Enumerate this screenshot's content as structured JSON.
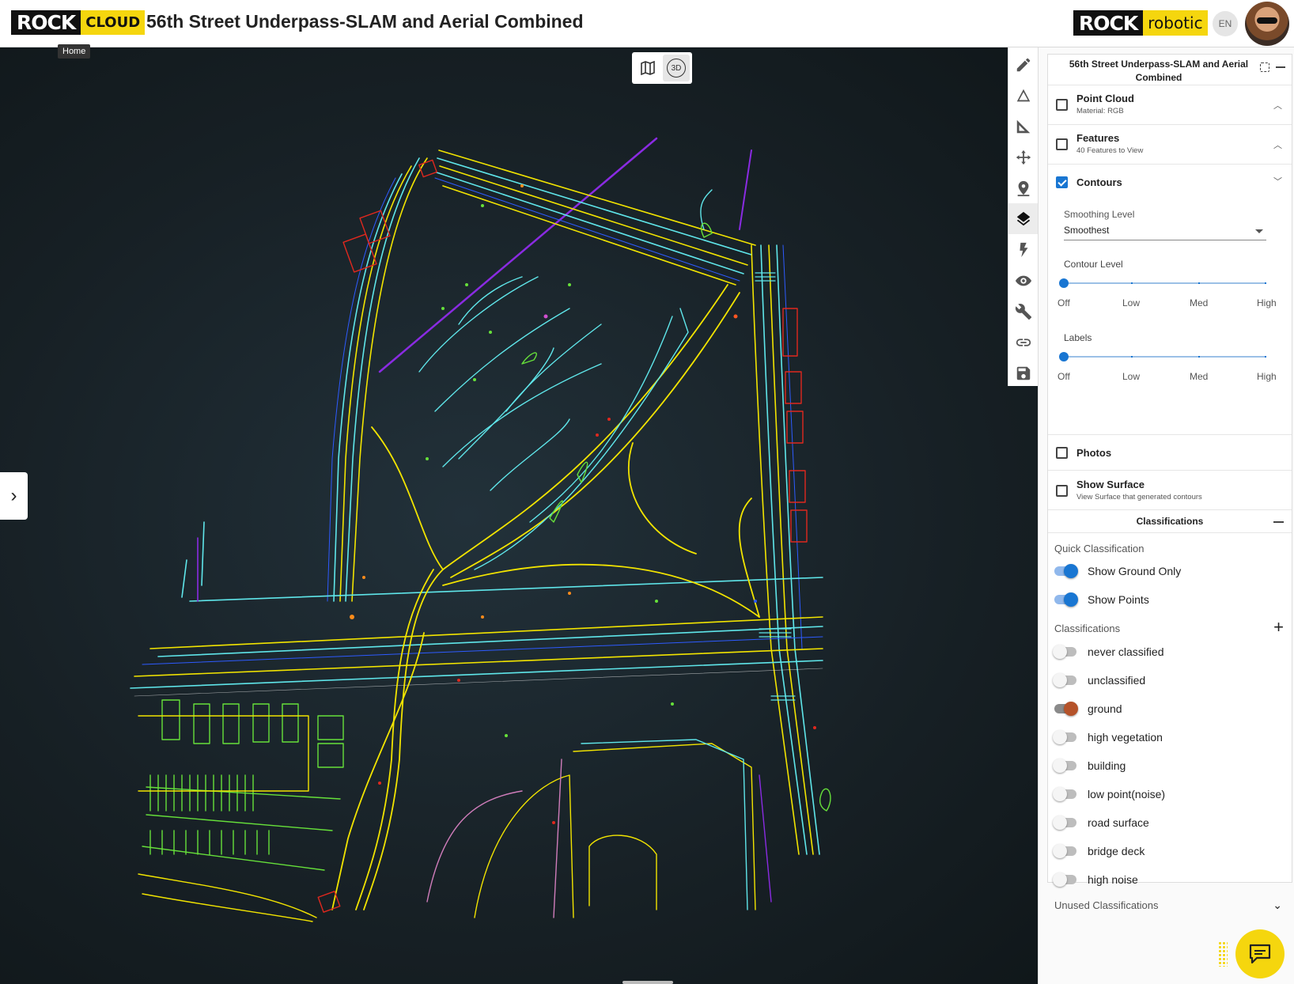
{
  "header": {
    "brand_left": {
      "part1": "ROCK",
      "part2": "CLOUD"
    },
    "title": "56th Street Underpass-SLAM and Aerial Combined",
    "tooltip": "Home",
    "brand_right": {
      "part1": "ROCK",
      "part2": "robotic"
    },
    "language": "EN"
  },
  "view_toggle": {
    "map_icon": "map-icon",
    "mode_3d_label": "3D"
  },
  "toolbar": {
    "tools": [
      "pencil-icon",
      "terrain-icon",
      "measure-icon",
      "move-icon",
      "location-pin-icon",
      "layers-icon",
      "lightning-icon",
      "eye-icon",
      "wrench-icon",
      "link-icon",
      "save-icon"
    ],
    "active_tool": "layers-icon"
  },
  "panel": {
    "project_title": "56th Street Underpass-SLAM and Aerial Combined",
    "layers": {
      "point_cloud": {
        "title": "Point Cloud",
        "sub": "Material: RGB",
        "checked": false
      },
      "features": {
        "title": "Features",
        "sub": "40 Features to View",
        "checked": false
      },
      "contours": {
        "title": "Contours",
        "checked": true
      }
    },
    "contours": {
      "smoothing_label": "Smoothing Level",
      "smoothing_value": "Smoothest",
      "contour_level_label": "Contour Level",
      "contour_level_value": "Off",
      "labels_label": "Labels",
      "labels_value": "Off",
      "ticks": [
        "Off",
        "Low",
        "Med",
        "High"
      ]
    },
    "photos": {
      "title": "Photos",
      "checked": false
    },
    "show_surface": {
      "title": "Show Surface",
      "sub": "View Surface that generated contours",
      "checked": false
    },
    "classifications": {
      "section_title": "Classifications",
      "quick_label": "Quick Classification",
      "quick": [
        {
          "label": "Show Ground Only",
          "on": true
        },
        {
          "label": "Show Points",
          "on": true
        }
      ],
      "list_label": "Classifications",
      "items": [
        {
          "label": "never classified",
          "on": false,
          "color": "#bdbdbd"
        },
        {
          "label": "unclassified",
          "on": false,
          "color": "#bdbdbd"
        },
        {
          "label": "ground",
          "on": true,
          "color": "#b5532a"
        },
        {
          "label": "high vegetation",
          "on": false,
          "color": "#bdbdbd"
        },
        {
          "label": "building",
          "on": false,
          "color": "#bdbdbd"
        },
        {
          "label": "low point(noise)",
          "on": false,
          "color": "#bdbdbd"
        },
        {
          "label": "road surface",
          "on": false,
          "color": "#bdbdbd"
        },
        {
          "label": "bridge deck",
          "on": false,
          "color": "#bdbdbd"
        },
        {
          "label": "high noise",
          "on": false,
          "color": "#bdbdbd"
        }
      ],
      "unused_label": "Unused Classifications"
    }
  },
  "colors": {
    "brand_yellow": "#f5d60e",
    "accent_blue": "#1976d2",
    "map_background": "#1b2326",
    "contour_yellow": "#f2e400",
    "contour_cyan": "#5fe6ea",
    "contour_green": "#66e03a",
    "contour_purple": "#8a2be2",
    "contour_red": "#e0281e"
  }
}
